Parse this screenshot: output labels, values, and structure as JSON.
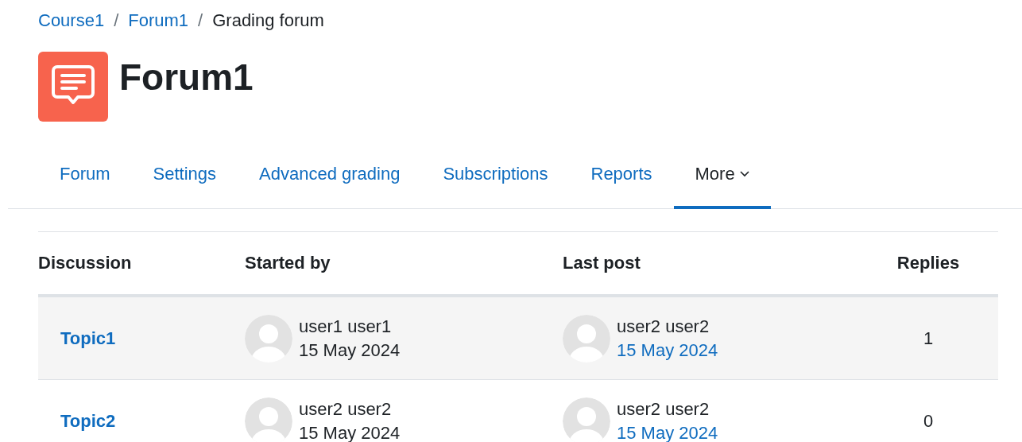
{
  "breadcrumb": [
    {
      "label": "Course1",
      "link": true
    },
    {
      "label": "Forum1",
      "link": true
    },
    {
      "label": "Grading forum",
      "link": false
    }
  ],
  "breadcrumb_separator": "/",
  "title": "Forum1",
  "tabs": [
    {
      "label": "Forum",
      "selected": false,
      "dropdown": false
    },
    {
      "label": "Settings",
      "selected": false,
      "dropdown": false
    },
    {
      "label": "Advanced grading",
      "selected": false,
      "dropdown": false
    },
    {
      "label": "Subscriptions",
      "selected": false,
      "dropdown": false
    },
    {
      "label": "Reports",
      "selected": false,
      "dropdown": false
    },
    {
      "label": "More",
      "selected": true,
      "dropdown": true
    }
  ],
  "table": {
    "columns": [
      "Discussion",
      "Started by",
      "Last post",
      "Replies"
    ],
    "rows": [
      {
        "discussion": "Topic1",
        "started_by": {
          "name": "user1 user1",
          "date": "15 May 2024"
        },
        "last_post": {
          "name": "user2 user2",
          "date": "15 May 2024"
        },
        "replies": "1"
      },
      {
        "discussion": "Topic2",
        "started_by": {
          "name": "user2 user2",
          "date": "15 May 2024"
        },
        "last_post": {
          "name": "user2 user2",
          "date": "15 May 2024"
        },
        "replies": "0"
      }
    ]
  }
}
